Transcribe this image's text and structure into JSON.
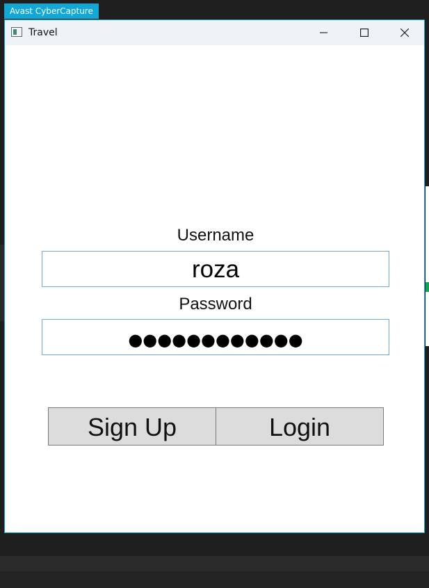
{
  "overlay": {
    "avast_tab": "Avast CyberCapture"
  },
  "window": {
    "title": "Travel",
    "controls": {
      "minimize_icon": "minimize-icon",
      "maximize_icon": "maximize-icon",
      "close_icon": "close-icon"
    }
  },
  "form": {
    "username_label": "Username",
    "username_value": "roza",
    "password_label": "Password",
    "password_value": "●●●●●●●●●●●●"
  },
  "buttons": {
    "signup_label": "Sign Up",
    "login_label": "Login"
  },
  "colors": {
    "accent": "#11a8d6",
    "window_border": "#17a4cf",
    "field_border": "#6fa7dc",
    "button_bg": "#dcdcdc"
  }
}
